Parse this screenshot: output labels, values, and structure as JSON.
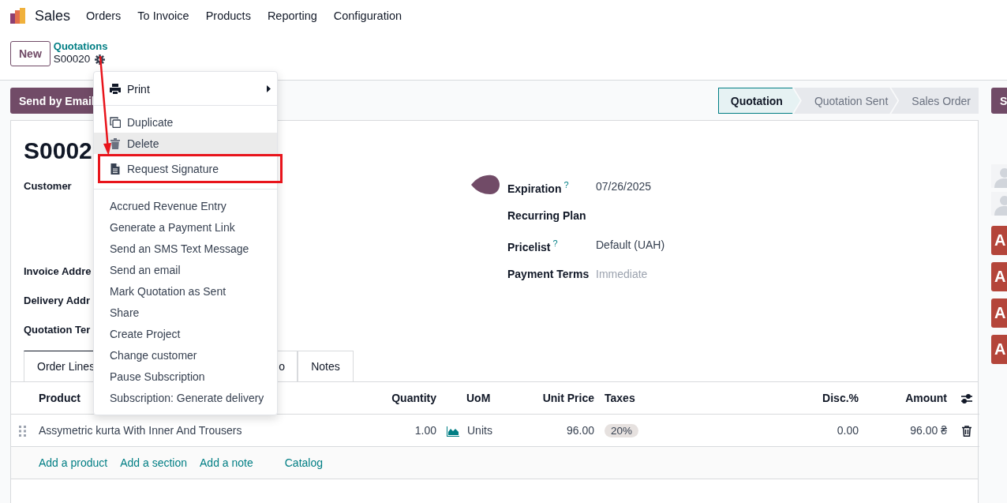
{
  "navbar": {
    "app": "Sales",
    "menus": [
      "Orders",
      "To Invoice",
      "Products",
      "Reporting",
      "Configuration"
    ]
  },
  "control_panel": {
    "new_button": "New",
    "breadcrumb": "Quotations",
    "record": "S00020"
  },
  "action_buttons": [
    "Send by Email"
  ],
  "statusbar": [
    {
      "label": "Quotation",
      "selected": true
    },
    {
      "label": "Quotation Sent",
      "selected": false
    },
    {
      "label": "Sales Order",
      "selected": false
    }
  ],
  "sheet": {
    "title": "S0002",
    "left_fields": [
      {
        "label": "Customer",
        "kind": "tall"
      },
      {
        "label": "Invoice Addre",
        "kind": "short"
      },
      {
        "label": "Delivery Addr",
        "kind": "short"
      },
      {
        "label": "Quotation Ter",
        "kind": "short"
      }
    ],
    "right_fields": [
      {
        "label": "Expiration",
        "help": "?",
        "value": "07/26/2025"
      },
      {
        "label": "Recurring Plan"
      },
      {
        "label": "Pricelist",
        "help": "?",
        "value": "Default (UAH)"
      },
      {
        "label": "Payment Terms",
        "placeholder": "Immediate"
      }
    ],
    "tabs": [
      {
        "label": "Order Lines",
        "selected": true
      },
      {
        "label": "o",
        "selected": false
      },
      {
        "label": "Notes",
        "selected": false
      }
    ],
    "table": {
      "columns": [
        "Product",
        "Quantity",
        "UoM",
        "Unit Price",
        "Taxes",
        "Disc.%",
        "Amount"
      ],
      "rows": [
        {
          "product": "Assymetric kurta With Inner And Trousers",
          "quantity": "1.00",
          "uom": "Units",
          "unit_price": "96.00",
          "taxes": "20%",
          "discount": "0.00",
          "amount": "96.00 ₴"
        }
      ],
      "add_links": [
        "Add a product",
        "Add a section",
        "Add a note",
        "Catalog"
      ]
    }
  },
  "menu": [
    [
      {
        "label": "Print",
        "submenu": true,
        "hovered": false,
        "annotated": false
      }
    ],
    [
      {
        "label": "Duplicate",
        "hovered": false,
        "annotated": false
      },
      {
        "label": "Delete",
        "hovered": true,
        "annotated": false
      },
      {
        "label": "Request Signature",
        "hovered": false,
        "annotated": true
      }
    ],
    [
      {
        "label": "Accrued Revenue Entry",
        "hovered": false,
        "annotated": false
      },
      {
        "label": "Generate a Payment Link",
        "hovered": false,
        "annotated": false
      },
      {
        "label": "Send an SMS Text Message",
        "hovered": false,
        "annotated": false
      },
      {
        "label": "Send an email",
        "hovered": false,
        "annotated": false
      },
      {
        "label": "Mark Quotation as Sent",
        "hovered": false,
        "annotated": false
      },
      {
        "label": "Share",
        "hovered": false,
        "annotated": false
      },
      {
        "label": "Create Project",
        "hovered": false,
        "annotated": false
      },
      {
        "label": "Change customer",
        "hovered": false,
        "annotated": false
      },
      {
        "label": "Pause Subscription",
        "hovered": false,
        "annotated": false
      },
      {
        "label": "Subscription: Generate delivery",
        "hovered": false,
        "annotated": false
      }
    ]
  ],
  "chatter": {
    "button": "S",
    "activities": [
      "A",
      "A",
      "A",
      "A"
    ]
  }
}
